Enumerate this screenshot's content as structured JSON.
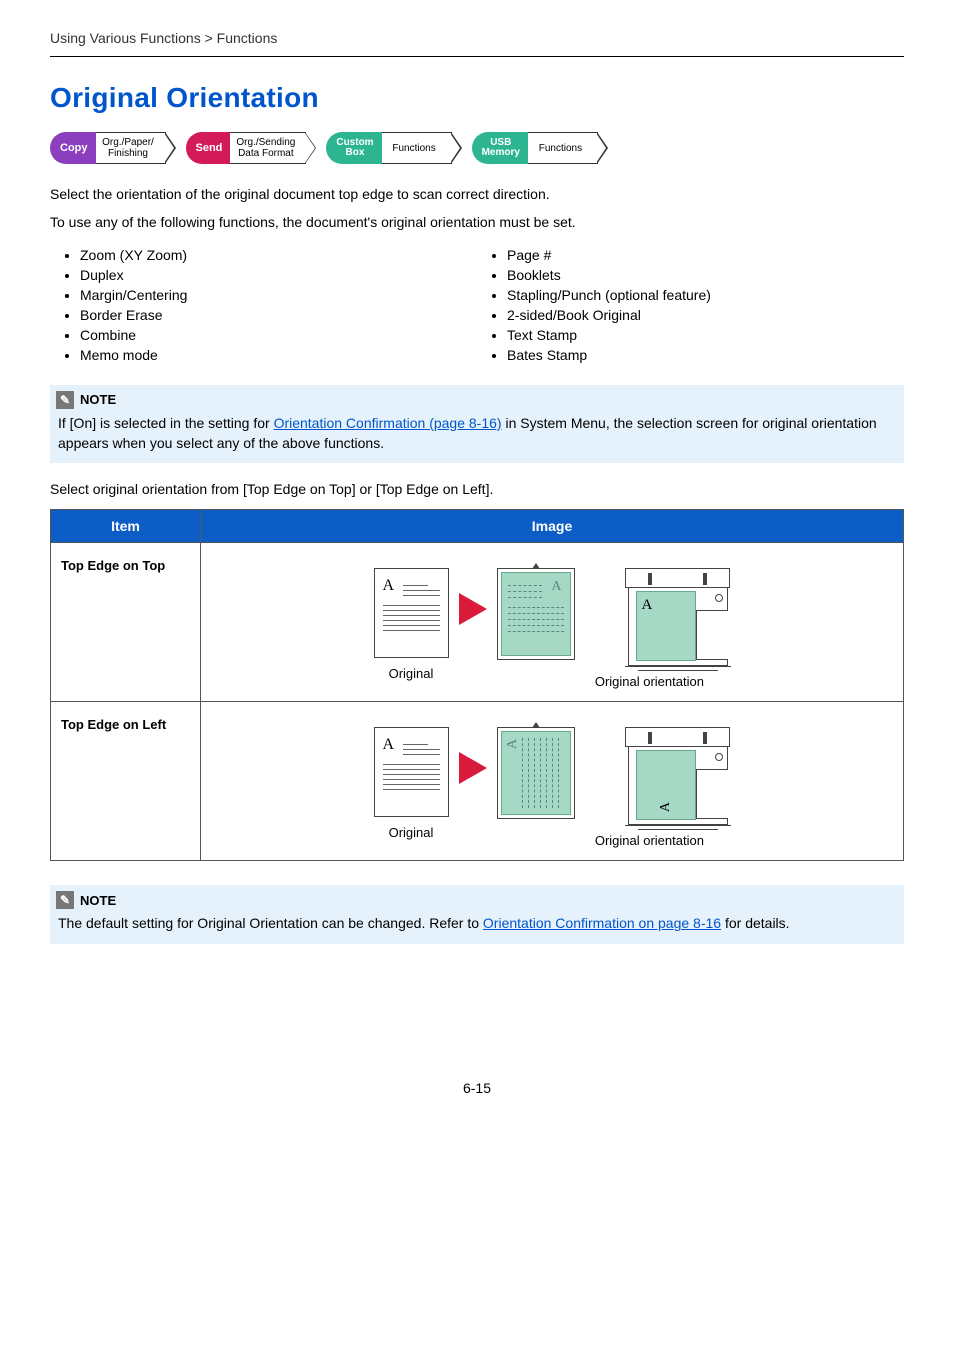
{
  "breadcrumb": "Using Various Functions > Functions",
  "heading": "Original Orientation",
  "icons": {
    "copy": {
      "pill": "Copy",
      "tag": "Org./Paper/\nFinishing"
    },
    "send": {
      "pill": "Send",
      "tag": "Org./Sending\nData Format"
    },
    "custom": {
      "pill": "Custom\nBox",
      "tag": "Functions"
    },
    "usb": {
      "pill": "USB\nMemory",
      "tag": "Functions"
    }
  },
  "intro1": "Select the orientation of the original document top edge to scan correct direction.",
  "intro2": "To use any of the following functions, the document's original orientation must be set.",
  "list_left": [
    "Zoom (XY Zoom)",
    "Duplex",
    "Margin/Centering",
    "Border Erase",
    "Combine",
    "Memo mode"
  ],
  "list_right": [
    "Page #",
    "Booklets",
    "Stapling/Punch (optional feature)",
    "2-sided/Book Original",
    "Text Stamp",
    "Bates Stamp"
  ],
  "note1": {
    "label": "NOTE",
    "pre": "If [On] is selected in the setting for ",
    "link": "Orientation Confirmation (page 8-16)",
    "post": " in System Menu, the selection screen for original orientation appears when you select any of the above functions."
  },
  "select_line": "Select original orientation from [Top Edge on Top] or [Top Edge on Left].",
  "table": {
    "headers": {
      "item": "Item",
      "image": "Image"
    },
    "rows": [
      {
        "item": "Top Edge on Top",
        "cap_orig": "Original",
        "cap_orient": "Original orientation"
      },
      {
        "item": "Top Edge on Left",
        "cap_orig": "Original",
        "cap_orient": "Original orientation"
      }
    ]
  },
  "note2": {
    "label": "NOTE",
    "pre": "The default setting for Original Orientation can be changed. Refer to ",
    "link": "Orientation Confirmation on page 8-16",
    "post": " for details."
  },
  "pagenum": "6-15"
}
